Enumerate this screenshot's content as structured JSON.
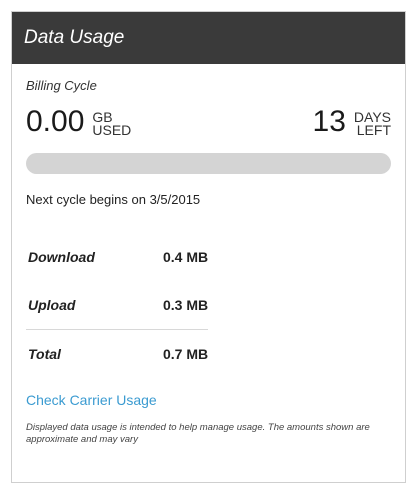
{
  "header": {
    "title": "Data Usage"
  },
  "billing": {
    "label": "Billing Cycle",
    "used_value": "0.00",
    "used_unit_top": "GB",
    "used_unit_bottom": "USED",
    "left_value": "13",
    "left_unit_top": "DAYS",
    "left_unit_bottom": "LEFT",
    "progress_fraction": 0.0
  },
  "next_cycle": "Next cycle begins on 3/5/2015",
  "usage": {
    "rows": [
      {
        "label": "Download",
        "value": "0.4 MB"
      },
      {
        "label": "Upload",
        "value": "0.3 MB"
      },
      {
        "label": "Total",
        "value": "0.7 MB"
      }
    ]
  },
  "links": {
    "check_carrier": "Check Carrier Usage"
  },
  "disclaimer": "Displayed data usage is intended to help manage usage. The amounts shown are approximate and may vary"
}
